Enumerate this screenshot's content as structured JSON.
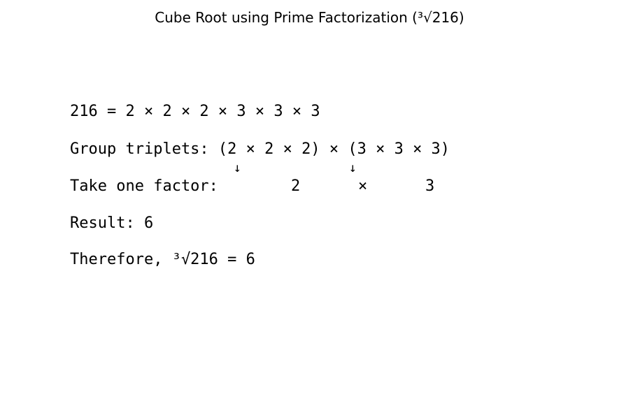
{
  "title": "Cube Root using Prime Factorization (³√216)",
  "lines": {
    "factorization": "216 = 2 × 2 × 2 × 3 × 3 × 3",
    "group_triplets": "Group triplets: (2 × 2 × 2) × (3 × 3 × 3)",
    "arrow_first": "↓",
    "arrow_second": "↓",
    "take_one_label": "Take one factor:",
    "factor_first": "2",
    "multiply_sign": "×",
    "factor_second": "3",
    "result": "Result: 6",
    "therefore": "Therefore, ³√216 = 6"
  }
}
